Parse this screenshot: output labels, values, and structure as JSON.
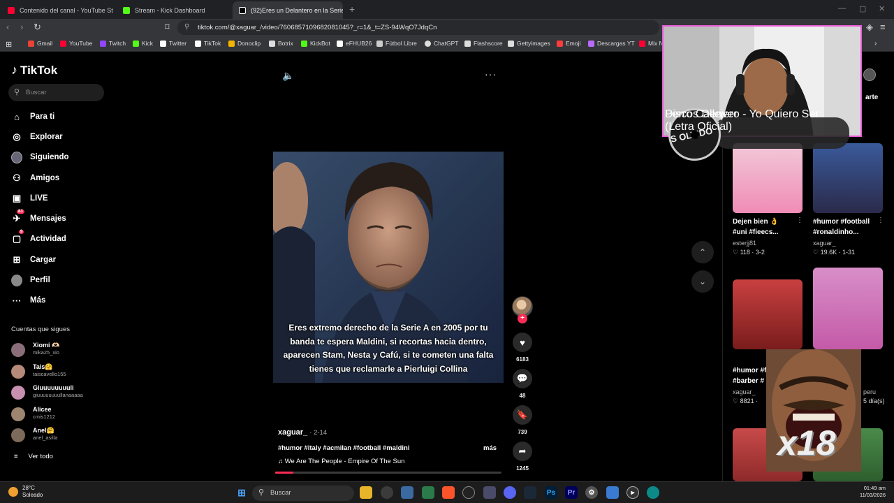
{
  "browser": {
    "tabs": [
      {
        "title": "Contenido del canal - YouTube Studi",
        "color": "#ff0033"
      },
      {
        "title": "Stream - Kick Dashboard",
        "color": "#53fc18"
      },
      {
        "title": "(92)Eres un Delantero en la Serie",
        "color": "#ffffff"
      }
    ],
    "url": "tiktok.com/@xaguar_/video/7606857109682081045?_r=1&_t=ZS-94WqO7JdqCn",
    "bookmarks": [
      {
        "label": "Gmail",
        "color": "#ea4335"
      },
      {
        "label": "YouTube",
        "color": "#ff0033"
      },
      {
        "label": "Twitch",
        "color": "#9146ff"
      },
      {
        "label": "Kick",
        "color": "#53fc18"
      },
      {
        "label": "Twitter",
        "color": "#ffffff"
      },
      {
        "label": "TikTok",
        "color": "#ffffff"
      },
      {
        "label": "Donoclip",
        "color": "#f5b400"
      },
      {
        "label": "Botrix",
        "color": "#dddddd"
      },
      {
        "label": "KickBot",
        "color": "#53fc18"
      },
      {
        "label": "eFHUB26",
        "color": "#ffffff"
      },
      {
        "label": "Fútbol Libre",
        "color": "#cccccc"
      },
      {
        "label": "ChatGPT",
        "color": "#dddddd"
      },
      {
        "label": "Flashscore",
        "color": "#dddddd"
      },
      {
        "label": "Gettyimages",
        "color": "#dddddd"
      },
      {
        "label": "Emoji",
        "color": "#ff3b3b"
      },
      {
        "label": "Descargas YT",
        "color": "#b86cff"
      },
      {
        "label": "Mix N",
        "color": "#ff0033"
      }
    ]
  },
  "sidebar": {
    "logo": "TikTok",
    "search_placeholder": "Buscar",
    "nav": [
      {
        "label": "Para ti",
        "icon": "home-icon"
      },
      {
        "label": "Explorar",
        "icon": "compass-icon"
      },
      {
        "label": "Siguiendo",
        "icon": "following-icon"
      },
      {
        "label": "Amigos",
        "icon": "friends-icon"
      },
      {
        "label": "LIVE",
        "icon": "live-icon"
      },
      {
        "label": "Mensajes",
        "icon": "messages-icon",
        "badge": "83"
      },
      {
        "label": "Actividad",
        "icon": "activity-icon",
        "badge": "9"
      },
      {
        "label": "Cargar",
        "icon": "upload-icon"
      },
      {
        "label": "Perfil",
        "icon": "profile-icon"
      },
      {
        "label": "Más",
        "icon": "more-icon"
      }
    ],
    "following_header": "Cuentas que sigues",
    "following": [
      {
        "name": "Xiomi 🫶🏻",
        "handle": "mika25_xio",
        "color": "#8a6f7a"
      },
      {
        "name": "Tais🤗",
        "handle": "taiscavello155",
        "color": "#b58a7a"
      },
      {
        "name": "Giuuuuuuuuli",
        "handle": "giuuuuuuuullanaaaaa",
        "color": "#c78fb0"
      },
      {
        "name": "Alicee",
        "handle": "cmis1212",
        "color": "#9d8570"
      },
      {
        "name": "Anel🤗",
        "handle": "anel_asilla",
        "color": "#7d6a5a"
      }
    ],
    "see_all": "Ver todo"
  },
  "video": {
    "caption": "Eres extremo derecho de la Serie A en 2005 por tu banda te espera Maldini, si recortas hacia dentro, aparecen Stam, Nesta y Cafú, si te cometen una falta tienes que reclamarle a Pierluigi Collina",
    "author": "xaguar_",
    "date": "· 2-14",
    "tags": "#humor #italy #acmilan #football #maldini",
    "more": "más",
    "music": "♫  We Are The People - Empire Of The Sun",
    "likes": "6183",
    "comments": "48",
    "saves": "739",
    "shares": "1245",
    "progress": 0.08
  },
  "right": {
    "share_label": "arte",
    "items": [
      {
        "title1": "Dejen bien 👌",
        "title2": "#uni #fieecs...",
        "author": "esterjj81",
        "stats": "♡ 118 · 3-2"
      },
      {
        "title1": "#humor #football",
        "title2": "#ronaldinho...",
        "author": "xaguar_",
        "stats": "♡ 19.6K · 1-31"
      },
      {
        "title1": "#humor #f",
        "title2": "#barber #",
        "author": "xaguar_",
        "stats": "♡ 8821 ·"
      },
      {
        "title1": "",
        "title2": "",
        "author": "peru",
        "stats": "5 día(s)"
      }
    ]
  },
  "overlay": {
    "np_artist": "Discos Denver",
    "np_track": "Perro Callejero - Yo Quiero Ser (Letra Oficial)",
    "meme_text": "x18",
    "disc_text": "IS OLVIDO"
  },
  "taskbar": {
    "temp": "28°C",
    "weather": "Soleado",
    "search": "Buscar",
    "time": "01:49 am",
    "date": "11/03/2026"
  },
  "colors": {
    "accent": "#fe2c55",
    "cam_border": "#e85ad6"
  }
}
